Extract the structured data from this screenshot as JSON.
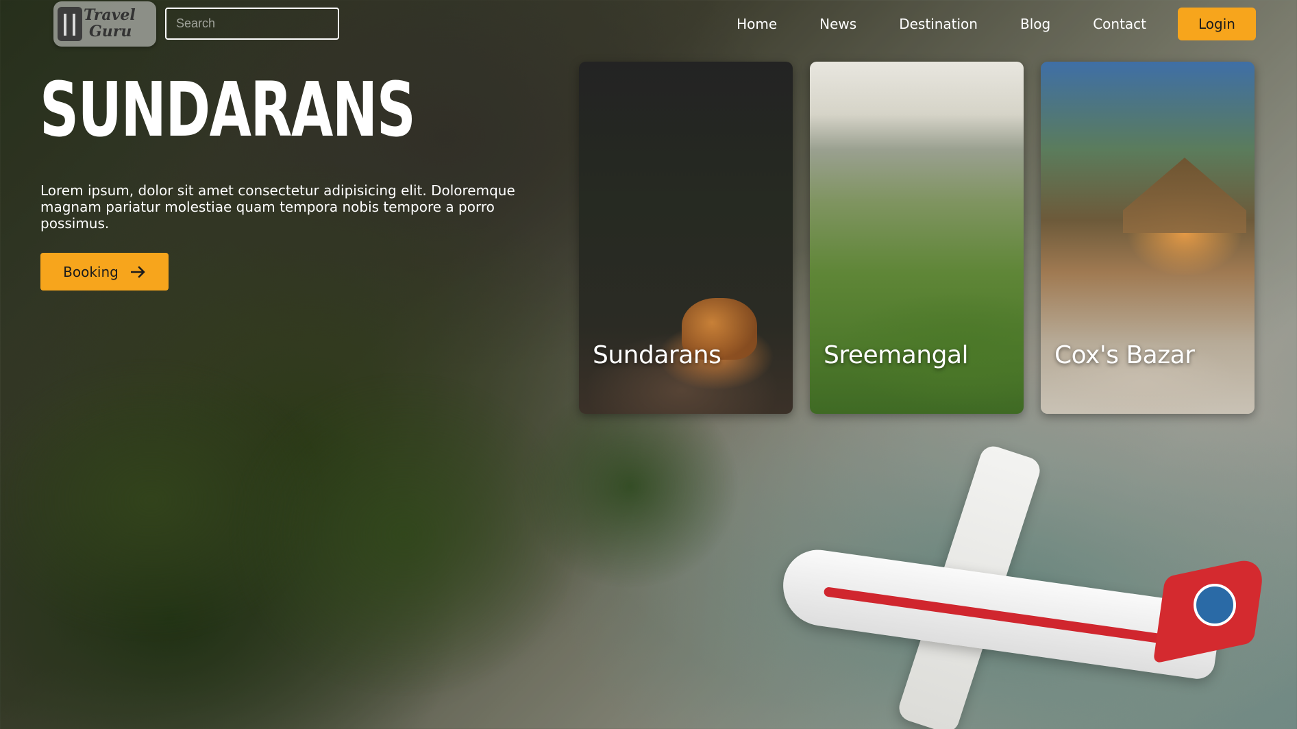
{
  "header": {
    "logo_line1": "Travel",
    "logo_line2": "Guru",
    "search_placeholder": "Search",
    "nav": [
      "Home",
      "News",
      "Destination",
      "Blog",
      "Contact"
    ],
    "login_label": "Login"
  },
  "hero": {
    "title": "SUNDARANS",
    "description": "Lorem ipsum, dolor sit amet consectetur adipisicing elit. Doloremque magnam pariatur molestiae quam tempora nobis tempore a porro possimus.",
    "booking_label": "Booking"
  },
  "cards": [
    {
      "label": "Sundarans"
    },
    {
      "label": "Sreemangal"
    },
    {
      "label": "Cox's Bazar"
    }
  ],
  "colors": {
    "accent": "#f7a51c"
  },
  "icons": {
    "booking": "arrow-right-icon",
    "logo": "luggage-icon"
  }
}
